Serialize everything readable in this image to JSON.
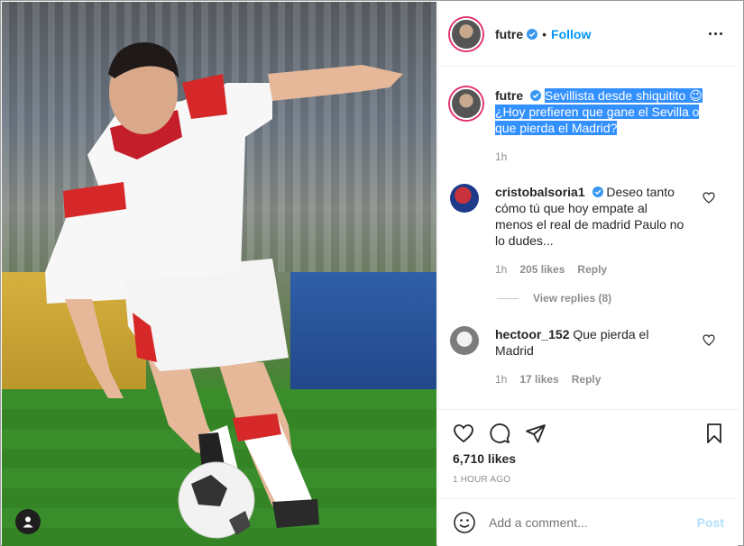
{
  "post": {
    "author": "futre",
    "follow_label": "Follow",
    "dot": "•",
    "caption_user": "futre",
    "caption_line1": "Sevillista desde shiquitito 😉",
    "caption_line2": "¿Hoy prefieren que gane el Sevilla o",
    "caption_line3": "que pierda el Madrid?",
    "caption_time": "1h"
  },
  "comments": [
    {
      "user": "cristobalsoria1",
      "text_line1": "Deseo tanto",
      "text_line2": "cómo tú que hoy empate al",
      "text_line3": "menos el real de madrid Paulo no",
      "text_line4": "lo dudes...",
      "time": "1h",
      "likes": "205 likes",
      "reply": "Reply",
      "view_replies": "View replies (8)"
    },
    {
      "user": "hectoor_152",
      "text_line1": "Que pierda el",
      "text_line2": "Madrid",
      "time": "1h",
      "likes": "17 likes",
      "reply": "Reply"
    }
  ],
  "stats": {
    "likes": "6,710 likes",
    "ago": "1 HOUR AGO"
  },
  "add_comment": {
    "placeholder": "Add a comment...",
    "post": "Post"
  },
  "colors": {
    "accent": "#0095f6",
    "selection": "#3390ff",
    "muted": "#8e8e8e"
  }
}
